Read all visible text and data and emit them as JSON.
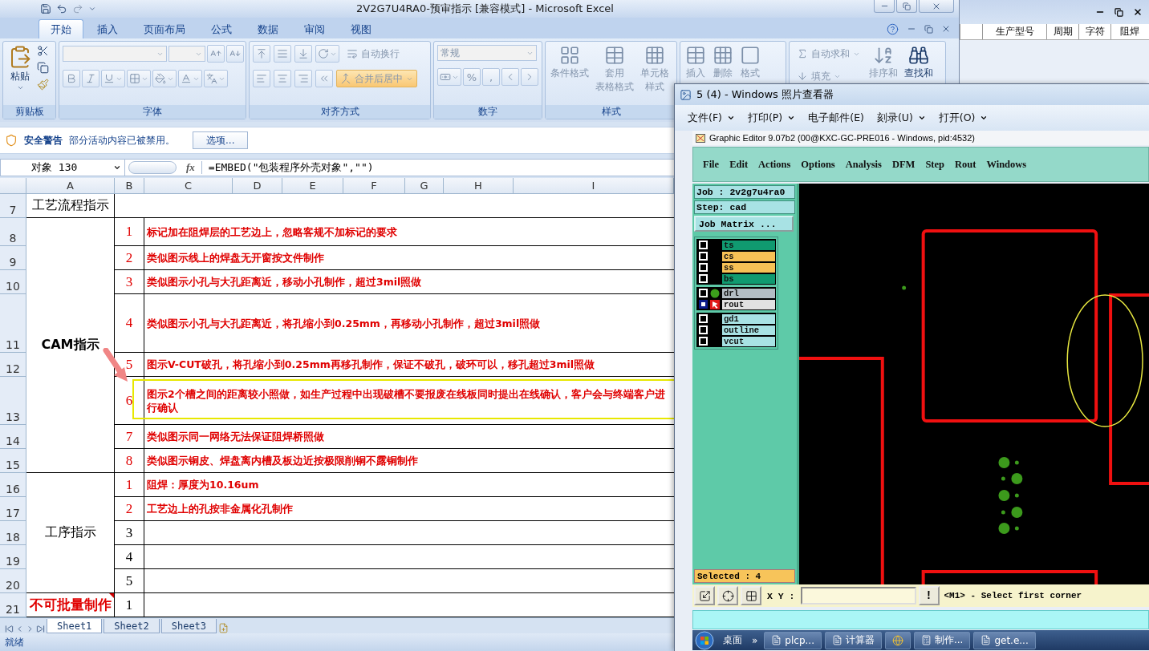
{
  "excel": {
    "title": "2V2G7U4RA0-预审指示  [兼容模式] - Microsoft Excel",
    "tabs": [
      {
        "label": "开始",
        "selected": true
      },
      {
        "label": "插入",
        "selected": false
      },
      {
        "label": "页面布局",
        "selected": false
      },
      {
        "label": "公式",
        "selected": false
      },
      {
        "label": "数据",
        "selected": false
      },
      {
        "label": "审阅",
        "selected": false
      },
      {
        "label": "视图",
        "selected": false
      }
    ],
    "ribbon": {
      "disabled": true,
      "clipboard": {
        "paste": "粘贴",
        "label": "剪贴板"
      },
      "font": {
        "label": "字体"
      },
      "alignment": {
        "wrap": "自动换行",
        "merge": "合并后居中",
        "label": "对齐方式"
      },
      "number": {
        "format": "常规",
        "symbols": [
          "%",
          ","
        ],
        "label": "数字"
      },
      "styles": {
        "buttons": [
          [
            "条件格式"
          ],
          [
            "套用",
            "表格格式"
          ],
          [
            "单元格",
            "样式"
          ]
        ],
        "label": "样式"
      },
      "cells": {
        "buttons": [
          "插入",
          "删除",
          "格式"
        ]
      },
      "editing": {
        "autosum": "自动求和",
        "fill": "填充",
        "buttons": [
          "排序和",
          "查找和"
        ]
      }
    },
    "security": {
      "title": "安全警告",
      "message": "部分活动内容已被禁用。",
      "button": "选项..."
    },
    "formula_bar": {
      "name_box": "对象 130",
      "fx_label": "fx",
      "formula": "=EMBED(\"包装程序外壳对象\",\"\")"
    },
    "columns": [
      "A",
      "B",
      "C",
      "D",
      "E",
      "F",
      "G",
      "H",
      "I"
    ],
    "row_numbers": [
      "7",
      "8",
      "9",
      "10",
      "11",
      "12",
      "13",
      "14",
      "15",
      "16",
      "17",
      "18",
      "19",
      "20",
      "21"
    ],
    "sections": [
      {
        "title": "工艺流程指示",
        "kind": "normal",
        "has_comment": false
      },
      {
        "title": "CAM指示",
        "kind": "strong",
        "has_comment": false,
        "items": [
          {
            "index": "1",
            "text": "标记加在阻焊层的工艺边上，忽略客规不加标记的要求"
          },
          {
            "index": "2",
            "text": "类似图示线上的焊盘无开窗按文件制作"
          },
          {
            "index": "3",
            "text": "类似图示小孔与大孔距离近，移动小孔制作，超过3mil照做"
          },
          {
            "index": "4",
            "text": "类似图示小孔与大孔距离近，将孔缩小到0.25mm，再移动小孔制作，超过3mil照做"
          },
          {
            "index": "5",
            "text": "图示V-CUT破孔，将孔缩小到0.25mm再移孔制作，保证不破孔，破环可以，移孔超过3mil照做"
          },
          {
            "index": "6",
            "text": "图示2个槽之间的距离较小照做，如生产过程中出现破槽不要报废在线板同时提出在线确认，客户会与终端客户进行确认"
          },
          {
            "index": "7",
            "text": "类似图示同一网络无法保证阻焊桥照做"
          },
          {
            "index": "8",
            "text": "类似图示铜皮、焊盘离内槽及板边近按极限削铜不露铜制作"
          }
        ]
      },
      {
        "title": "工序指示",
        "kind": "normal",
        "has_comment": false,
        "items": [
          {
            "index": "1",
            "text": "阻焊：厚度为10.16um"
          },
          {
            "index": "2",
            "text": "工艺边上的孔按非金属化孔制作"
          },
          {
            "index": "3"
          },
          {
            "index": "4"
          },
          {
            "index": "5"
          }
        ]
      },
      {
        "title": "不可批量制作",
        "kind": "alert",
        "has_comment": true,
        "items": [
          {
            "index": "1"
          }
        ]
      }
    ],
    "sheet_tabs": [
      {
        "label": "Sheet1",
        "selected": true
      },
      {
        "label": "Sheet2",
        "selected": false
      },
      {
        "label": "Sheet3",
        "selected": false
      }
    ],
    "status": "就绪"
  },
  "background_window": {
    "columns": [
      "生产型号",
      "周期",
      "字符",
      "阻焊"
    ]
  },
  "viewer": {
    "title": "5 (4) - Windows 照片查看器",
    "menu": [
      {
        "label": "文件(F)",
        "dropdown": true
      },
      {
        "label": "打印(P)",
        "dropdown": true
      },
      {
        "label": "电子邮件(E)",
        "dropdown": false
      },
      {
        "label": "刻录(U)",
        "dropdown": true
      },
      {
        "label": "打开(O)",
        "dropdown": true
      }
    ]
  },
  "editor": {
    "title": "Graphic Editor 9.07b2 (00@KXC-GC-PRE016 - Windows, pid:4532)",
    "menu": [
      "File",
      "Edit",
      "Actions",
      "Options",
      "Analysis",
      "DFM",
      "Step",
      "Rout",
      "Windows"
    ],
    "job": "Job : 2v2g7u4ra0",
    "step": "Step: cad",
    "matrix_button": "Job Matrix ...",
    "layer_groups": [
      [
        {
          "name": "ts",
          "color": "#109a70",
          "checked": false,
          "kind": "plain"
        },
        {
          "name": "cs",
          "color": "#f6c156",
          "checked": false,
          "kind": "plain"
        },
        {
          "name": "ss",
          "color": "#f6c156",
          "checked": false,
          "kind": "plain"
        },
        {
          "name": "bs",
          "color": "#109a70",
          "checked": false,
          "kind": "plain"
        }
      ],
      [
        {
          "name": "drl",
          "color": "#b4bec4",
          "checked": false,
          "kind": "drill"
        },
        {
          "name": "rout",
          "color": "#e2e2e2",
          "checked": true,
          "kind": "rout"
        }
      ],
      [
        {
          "name": "gd1",
          "color": "#a8e2e4",
          "checked": false,
          "kind": "plain"
        },
        {
          "name": "outline",
          "color": "#a8e2e4",
          "checked": false,
          "kind": "plain"
        },
        {
          "name": "vcut",
          "color": "#a8e2e4",
          "checked": false,
          "kind": "plain"
        }
      ]
    ],
    "selected": "Selected : 4",
    "xy_label": "X Y :",
    "alert_button": "!",
    "prompt": "<M1> - Select first corner"
  },
  "taskbar": {
    "items": [
      {
        "kind": "text",
        "label": "桌面"
      },
      {
        "kind": "text",
        "label": "»"
      },
      {
        "kind": "app",
        "label": "plcp..."
      },
      {
        "kind": "app",
        "label": "计算器"
      },
      {
        "kind": "icon"
      },
      {
        "kind": "app",
        "label": "制作..."
      },
      {
        "kind": "app",
        "label": "get.e..."
      }
    ]
  }
}
